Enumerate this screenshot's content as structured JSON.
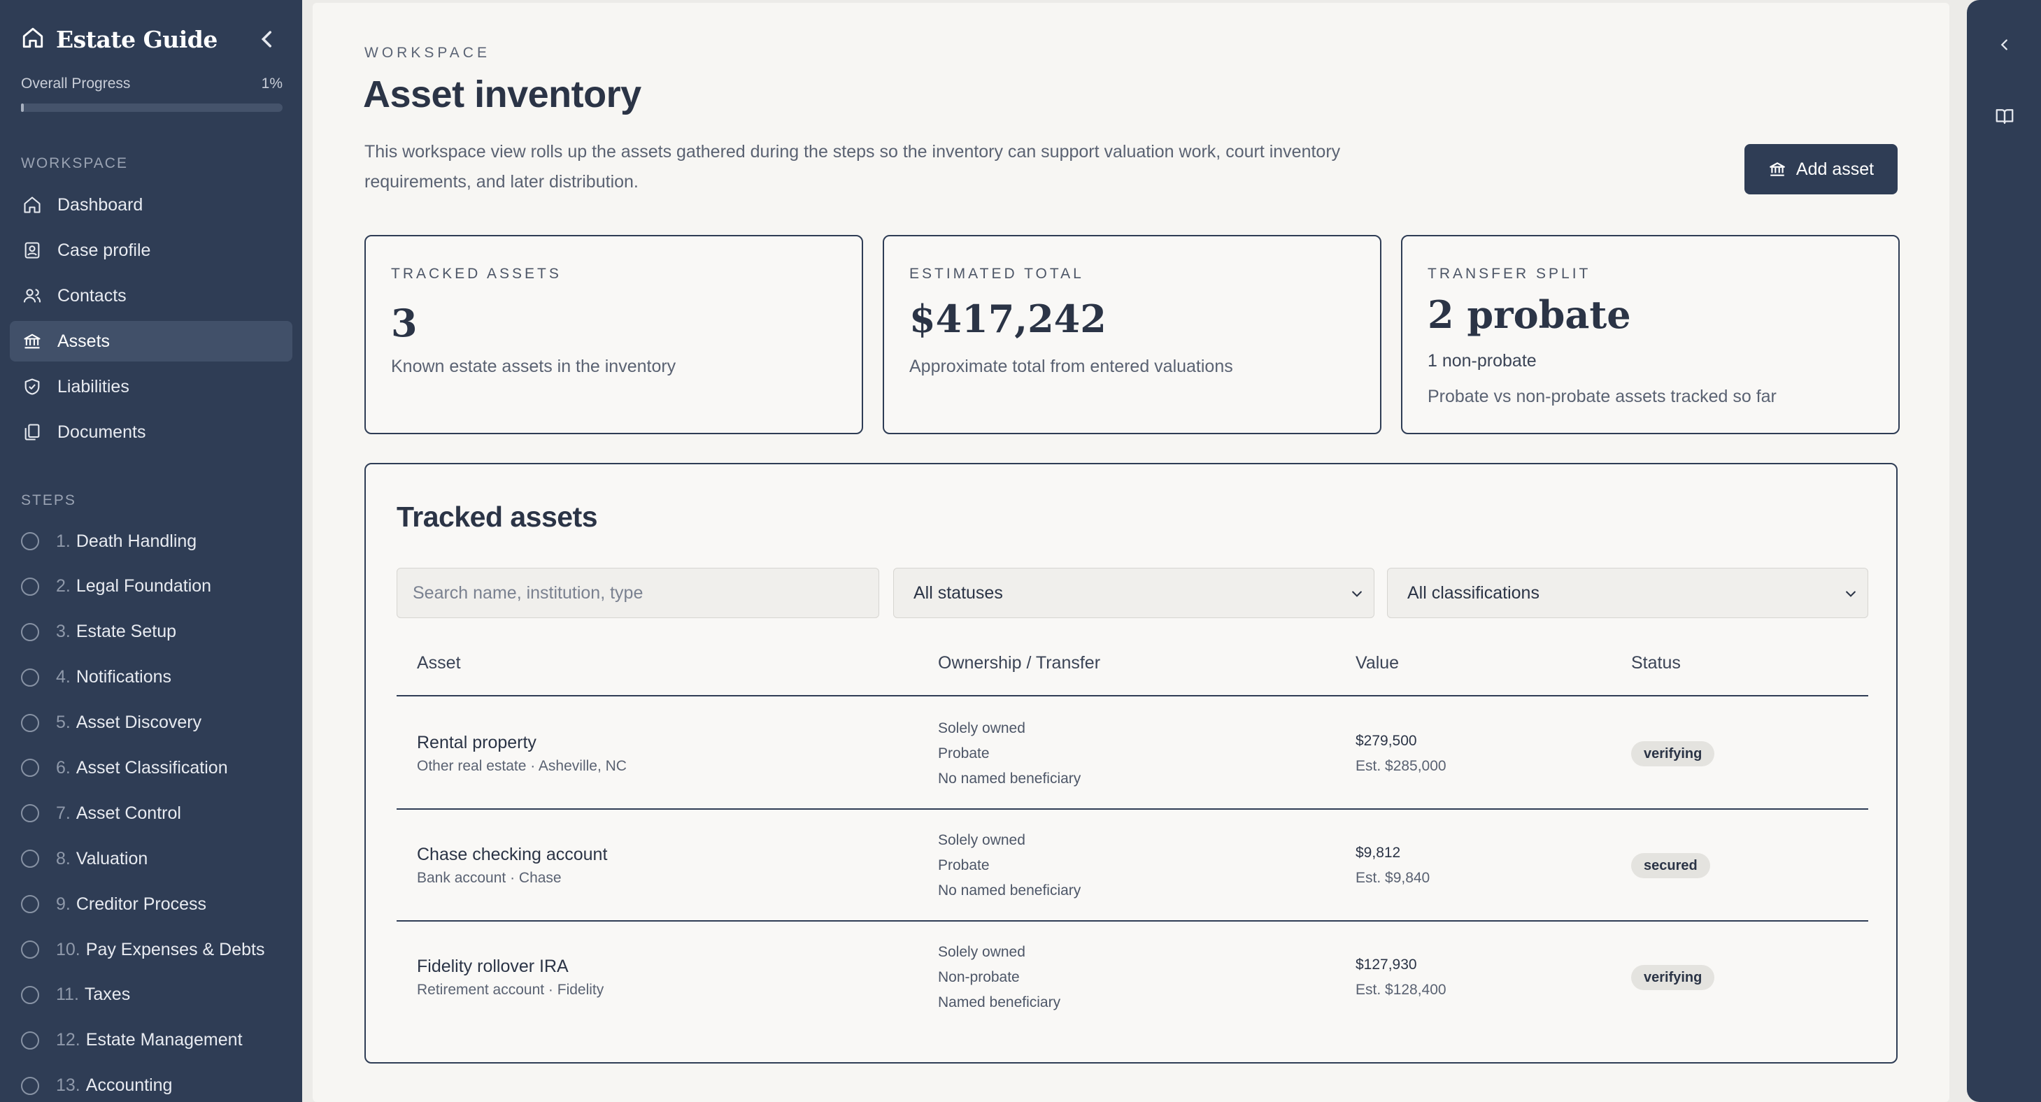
{
  "sidebar": {
    "brand": "Estate Guide",
    "progress_label": "Overall Progress",
    "progress_value": "1%",
    "progress_fraction": 0.01,
    "workspace_label": "WORKSPACE",
    "workspace_items": [
      {
        "label": "Dashboard",
        "icon": "home-icon"
      },
      {
        "label": "Case profile",
        "icon": "id-card-icon"
      },
      {
        "label": "Contacts",
        "icon": "users-icon"
      },
      {
        "label": "Assets",
        "icon": "bank-icon",
        "active": true
      },
      {
        "label": "Liabilities",
        "icon": "shield-check-icon"
      },
      {
        "label": "Documents",
        "icon": "files-icon"
      }
    ],
    "steps_label": "STEPS",
    "steps": [
      {
        "num": "1.",
        "label": "Death Handling"
      },
      {
        "num": "2.",
        "label": "Legal Foundation"
      },
      {
        "num": "3.",
        "label": "Estate Setup"
      },
      {
        "num": "4.",
        "label": "Notifications"
      },
      {
        "num": "5.",
        "label": "Asset Discovery"
      },
      {
        "num": "6.",
        "label": "Asset Classification"
      },
      {
        "num": "7.",
        "label": "Asset Control"
      },
      {
        "num": "8.",
        "label": "Valuation"
      },
      {
        "num": "9.",
        "label": "Creditor Process"
      },
      {
        "num": "10.",
        "label": "Pay Expenses & Debts"
      },
      {
        "num": "11.",
        "label": "Taxes"
      },
      {
        "num": "12.",
        "label": "Estate Management"
      },
      {
        "num": "13.",
        "label": "Accounting"
      }
    ]
  },
  "header": {
    "eyebrow": "WORKSPACE",
    "title": "Asset inventory",
    "description": "This workspace view rolls up the assets gathered during the steps so the inventory can support valuation work, court inventory requirements, and later distribution.",
    "add_button": "Add asset"
  },
  "cards": {
    "tracked": {
      "label": "TRACKED ASSETS",
      "value": "3",
      "sub": "Known estate assets in the inventory"
    },
    "total": {
      "label": "ESTIMATED TOTAL",
      "value": "$417,242",
      "sub": "Approximate total from entered valuations"
    },
    "split": {
      "label": "TRANSFER SPLIT",
      "value": "2 probate",
      "sub2": "1 non-probate",
      "sub": "Probate vs non-probate assets tracked so far"
    }
  },
  "table": {
    "title": "Tracked assets",
    "search_placeholder": "Search name, institution, type",
    "status_filter": "All statuses",
    "class_filter": "All classifications",
    "columns": [
      "Asset",
      "Ownership / Transfer",
      "Value",
      "Status"
    ],
    "rows": [
      {
        "name": "Rental property",
        "meta": "Other real estate · Asheville, NC",
        "ownership": "Solely owned",
        "transfer": "Probate",
        "beneficiary": "No named beneficiary",
        "value": "$279,500",
        "estimate": "Est. $285,000",
        "status": "verifying"
      },
      {
        "name": "Chase checking account",
        "meta": "Bank account · Chase",
        "ownership": "Solely owned",
        "transfer": "Probate",
        "beneficiary": "No named beneficiary",
        "value": "$9,812",
        "estimate": "Est. $9,840",
        "status": "secured"
      },
      {
        "name": "Fidelity rollover IRA",
        "meta": "Retirement account · Fidelity",
        "ownership": "Solely owned",
        "transfer": "Non-probate",
        "beneficiary": "Named beneficiary",
        "value": "$127,930",
        "estimate": "Est. $128,400",
        "status": "verifying"
      }
    ]
  }
}
